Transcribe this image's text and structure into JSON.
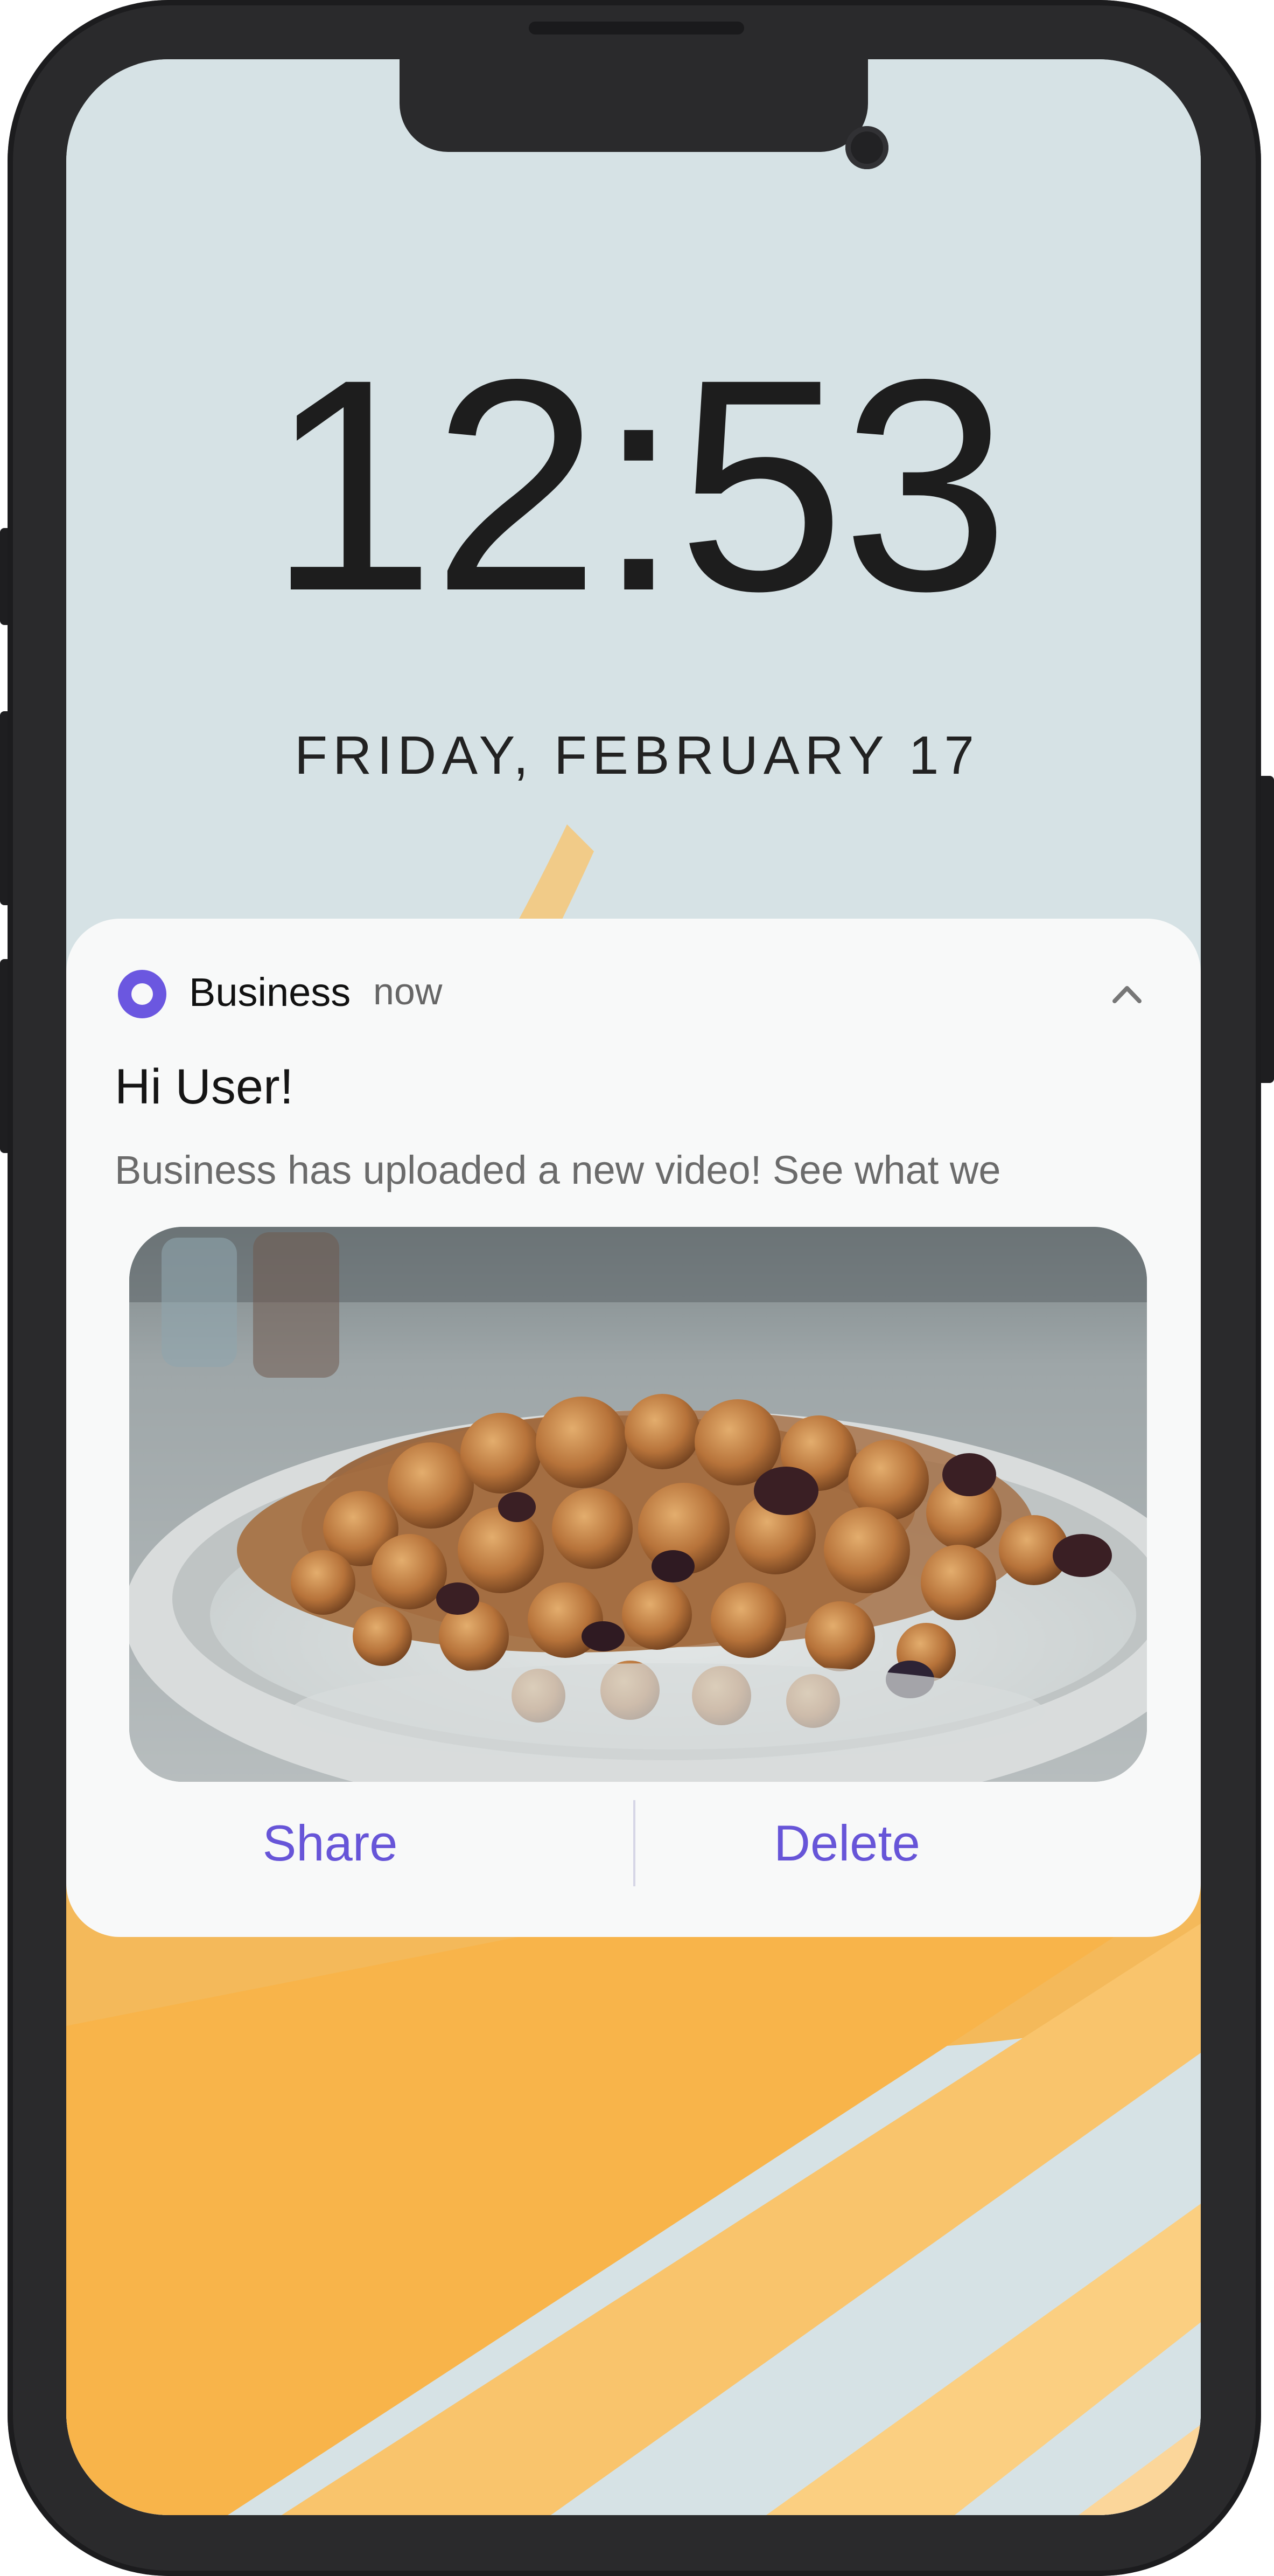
{
  "lockscreen": {
    "time": "12:53",
    "date": "FRIDAY, FEBRUARY 17"
  },
  "notification": {
    "app_name": "Business",
    "timestamp": "now",
    "title": "Hi User!",
    "body": "Business has uploaded a new video! See what we",
    "media_description": "bowl of granola cereal with milk",
    "actions": {
      "share_label": "Share",
      "delete_label": "Delete"
    },
    "icons": {
      "app": "circle-app-icon",
      "collapse": "chevron-up-icon"
    }
  },
  "colors": {
    "accent": "#6b57e0",
    "wallpaper_base": "#d6e2e5",
    "wallpaper_stripe": "#f7b54a",
    "notification_bg": "#f8f9f9"
  }
}
